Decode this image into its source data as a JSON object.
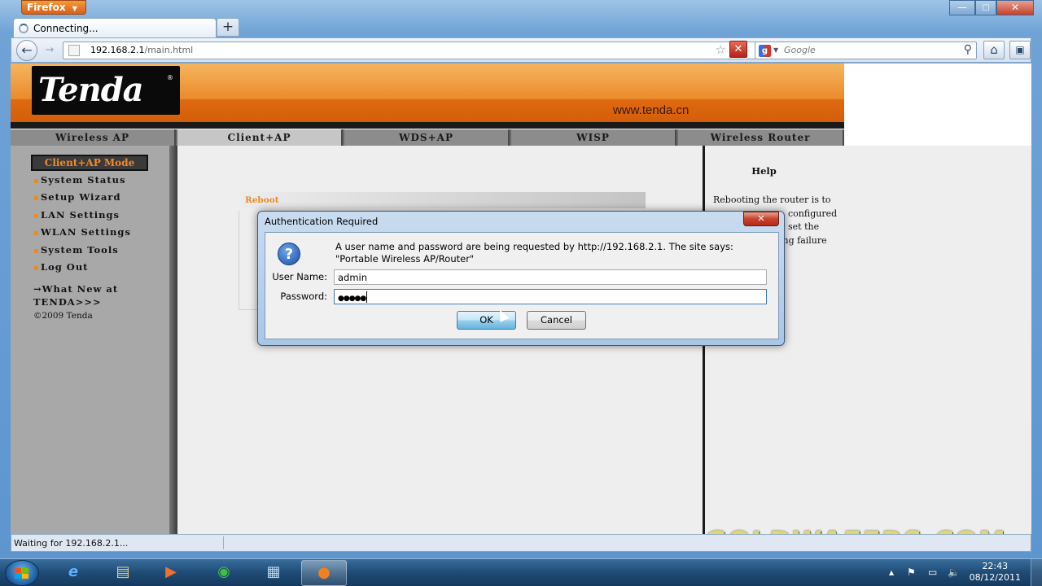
{
  "browser": {
    "menu_label": "Firefox",
    "window_controls": [
      "—",
      "☐",
      "✕"
    ],
    "tab_title": "Connecting...",
    "new_tab_glyph": "+",
    "back_glyph": "←",
    "forward_glyph": "→",
    "url_host": "192.168.2.1",
    "url_path": "/main.html",
    "star_glyph": "☆",
    "dropdown_glyph": "▼",
    "stop_glyph": "✕",
    "search_engine_glyph": "g",
    "search_placeholder": "Google",
    "search_glyph": "⚲",
    "home_glyph": "⌂",
    "addon_glyph": "▣",
    "status_text": "Waiting for 192.168.2.1..."
  },
  "tenda": {
    "logo": "Tenda",
    "logo_reg": "®",
    "site_url": "www.tenda.cn",
    "mode_tabs": [
      "Wireless AP",
      "Client+AP",
      "WDS+AP",
      "WISP",
      "Wireless Router"
    ],
    "active_mode": "Client+AP",
    "sidebar_title": "Client+AP Mode",
    "sidebar_items": [
      "System Status",
      "Setup Wizard",
      "LAN Settings",
      "WLAN Settings",
      "System Tools",
      "Log Out"
    ],
    "whats_new": "→What New at TENDA>>>",
    "copyright": "©2009 Tenda",
    "section_title": "Reboot",
    "help_title": "Help",
    "help_text_lines": [
      "Rebooting the router is to",
      "configured",
      "set the",
      "ing failure"
    ]
  },
  "dialog": {
    "title": "Authentication Required",
    "close_glyph": "✕",
    "icon_glyph": "?",
    "message": "A user name and password are being requested by http://192.168.2.1. The site says: \"Portable Wireless AP/Router\"",
    "username_label": "User Name:",
    "username_value": "admin",
    "password_label": "Password:",
    "password_value": "●●●●●",
    "ok_label": "OK",
    "cancel_label": "Cancel"
  },
  "watermark": "GOLDWAFERS.COM",
  "taskbar": {
    "apps": [
      "e",
      "▤",
      "▶",
      "◉",
      "▦",
      "●"
    ],
    "tray_icons": [
      "▲",
      "⚑",
      "▭",
      "🔈"
    ],
    "time": "22:43",
    "date": "08/12/2011"
  },
  "colors": {
    "tenda_orange": "#e06a10",
    "tenda_accent": "#f28a2a",
    "firefox_orange": "#d9601a",
    "dialog_frame": "#a9c6e6"
  }
}
